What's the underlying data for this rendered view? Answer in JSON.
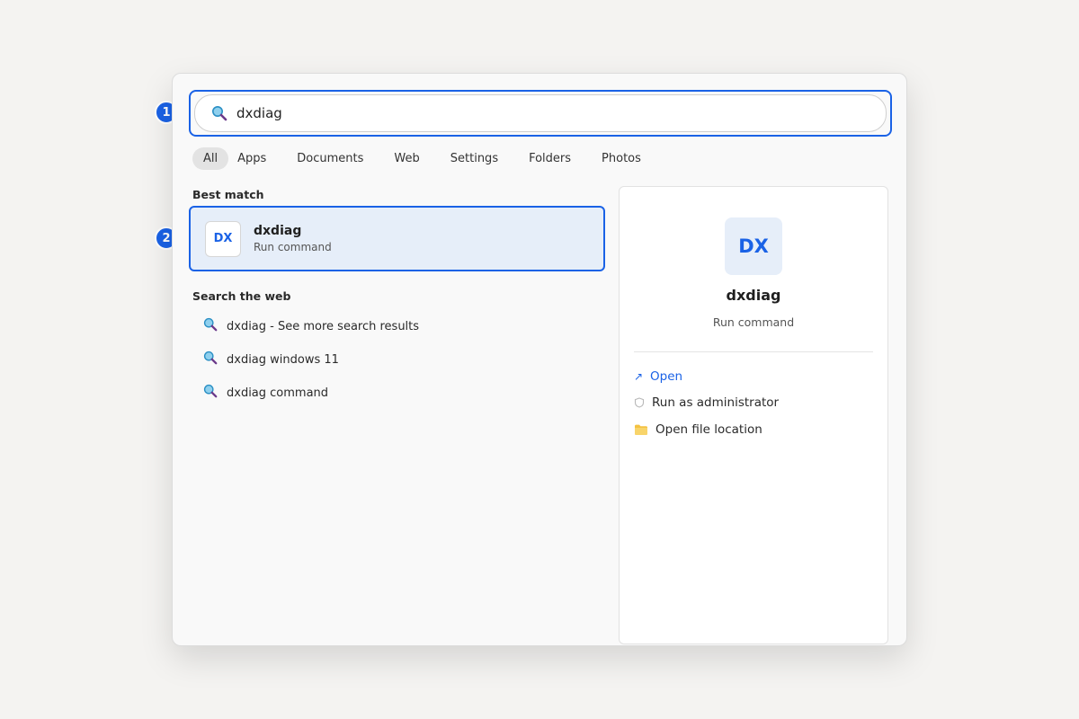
{
  "search": {
    "query": "dxdiag"
  },
  "badges": [
    "1",
    "2"
  ],
  "tabs": [
    "All",
    "Apps",
    "Documents",
    "Web",
    "Settings",
    "Folders",
    "Photos"
  ],
  "best_match": {
    "label": "Best match",
    "icon_text": "DX",
    "title": "dxdiag",
    "subtitle": "Run command"
  },
  "web": {
    "label": "Search the web",
    "items": [
      "dxdiag - See more search results",
      "dxdiag windows 11",
      "dxdiag command"
    ]
  },
  "detail": {
    "icon_text": "DX",
    "title": "dxdiag",
    "subtitle": "Run command",
    "actions": [
      "Open",
      "Run as administrator",
      "Open file location"
    ]
  },
  "colors": {
    "accent": "#1a62e6",
    "selection": "#e6eef9",
    "folder": "#f4c241"
  },
  "icons": {
    "search": "search-icon",
    "open": "open-arrow-icon",
    "admin": "shield-icon",
    "location": "folder-icon"
  }
}
